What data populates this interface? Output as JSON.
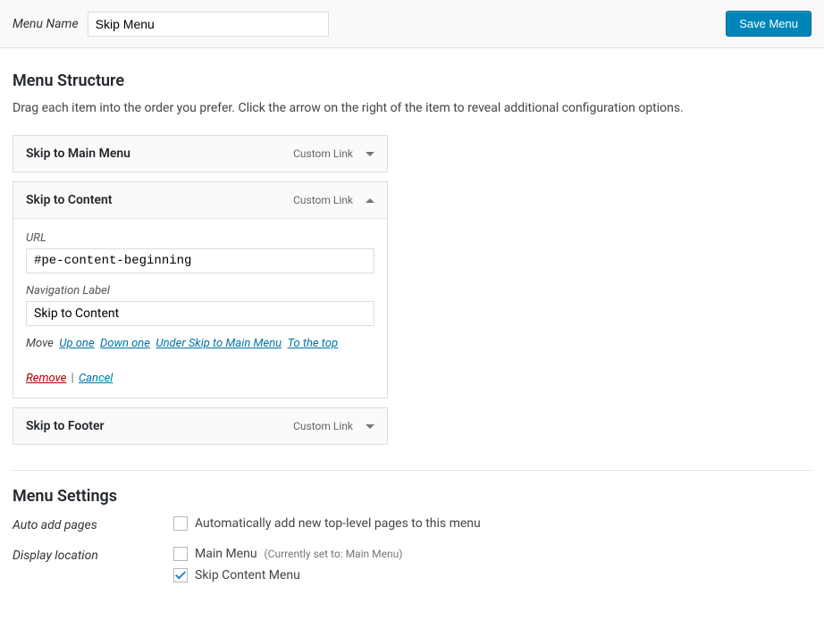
{
  "header": {
    "menu_name_label": "Menu Name",
    "menu_name_value": "Skip Menu",
    "save_button": "Save Menu"
  },
  "structure": {
    "title": "Menu Structure",
    "instruction": "Drag each item into the order you prefer. Click the arrow on the right of the item to reveal additional configuration options.",
    "items": [
      {
        "title": "Skip to Main Menu",
        "type": "Custom Link",
        "expanded": false
      },
      {
        "title": "Skip to Content",
        "type": "Custom Link",
        "expanded": true,
        "url_label": "URL",
        "url_value": "#pe-content-beginning",
        "nav_label_label": "Navigation Label",
        "nav_label_value": "Skip to Content",
        "move_label": "Move",
        "move_links": {
          "up": "Up one",
          "down": "Down one",
          "under": "Under Skip to Main Menu",
          "top": "To the top"
        },
        "remove": "Remove",
        "separator": " | ",
        "cancel": "Cancel"
      },
      {
        "title": "Skip to Footer",
        "type": "Custom Link",
        "expanded": false
      }
    ]
  },
  "settings": {
    "title": "Menu Settings",
    "auto_add_label": "Auto add pages",
    "auto_add_checkbox": "Automatically add new top-level pages to this menu",
    "display_location_label": "Display location",
    "locations": [
      {
        "label": "Main Menu",
        "hint": "(Currently set to: Main Menu)",
        "checked": false
      },
      {
        "label": "Skip Content Menu",
        "hint": "",
        "checked": true
      }
    ]
  }
}
